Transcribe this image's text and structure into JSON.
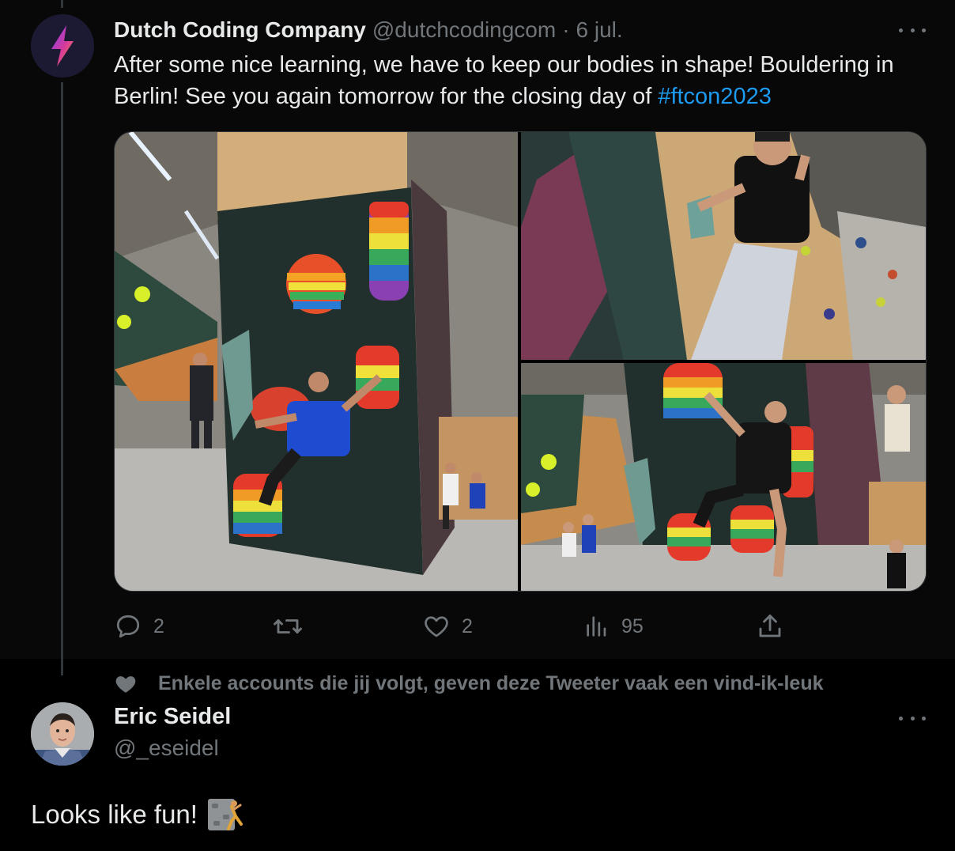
{
  "tweet": {
    "author_name": "Dutch Coding Company",
    "author_handle": "@dutchcodingcom",
    "separator": "·",
    "date": "6 jul.",
    "text_before": "After some nice learning, we have to keep our bodies in shape! Bouldering in Berlin! See you again tomorrow for the closing day of ",
    "hashtag": "#ftcon2023",
    "actions": {
      "replies": "2",
      "retweets": "",
      "likes": "2",
      "views": "95"
    },
    "photos": [
      {
        "alt": "climber-blue-shirt-photo"
      },
      {
        "alt": "climber-black-shirt-photo"
      },
      {
        "alt": "climbers-group-photo"
      }
    ]
  },
  "social_context": {
    "text": "Enkele accounts die jij volgt, geven deze Tweeter vaak een vind-ik-leuk"
  },
  "reply": {
    "author_name": "Eric Seidel",
    "author_handle": "@_eseidel",
    "text": "Looks like fun!",
    "emoji_name": "person-climbing-emoji"
  },
  "icons": {
    "reply": "speech-bubble-icon",
    "retweet": "retweet-icon",
    "like": "heart-icon",
    "views": "bar-chart-icon",
    "share": "upload-icon",
    "more": "ellipsis-icon"
  },
  "colors": {
    "background": "#000000",
    "text": "#e7e9ea",
    "muted": "#71767b",
    "accent": "#1d9bf0"
  }
}
